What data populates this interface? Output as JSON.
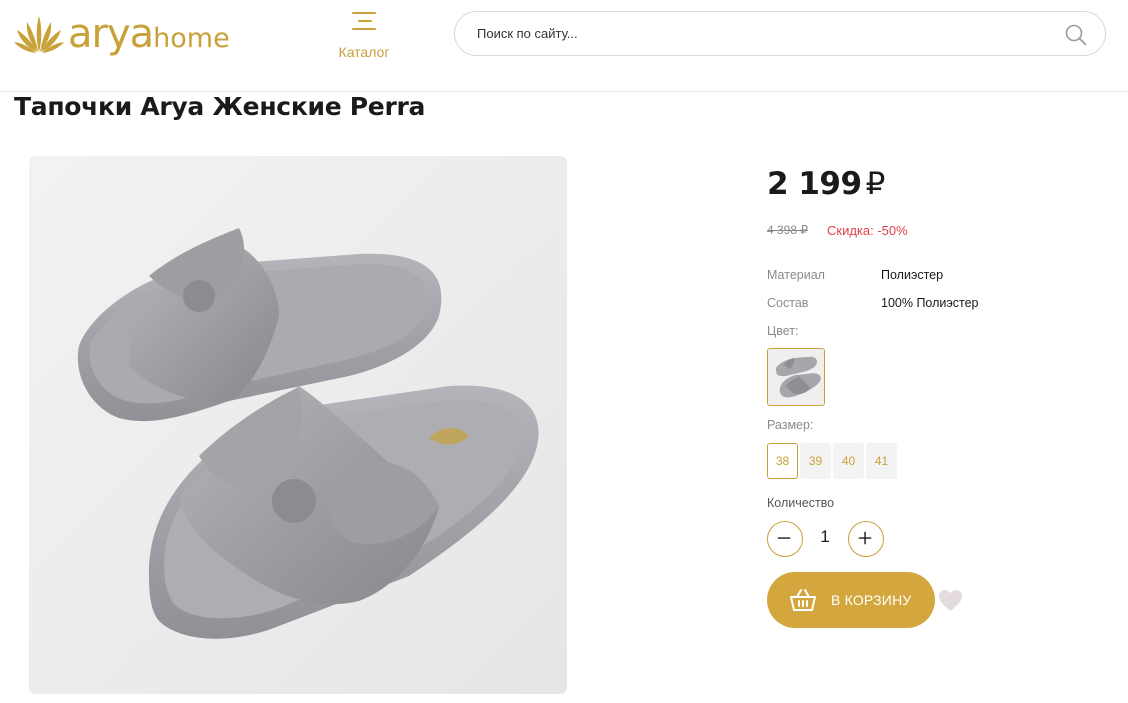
{
  "header": {
    "logo_alt": "aryahome",
    "logo_part1": "arya",
    "logo_part2": "home",
    "catalog_label": "Каталог",
    "search_placeholder": "Поиск по сайту..."
  },
  "product": {
    "title": "Тапочки Arya Женские Perra",
    "price": "2 199",
    "currency": "₽",
    "old_price": "4 398 ₽",
    "discount": "Скидка: -50%",
    "attributes": [
      {
        "key": "Материал",
        "value": "Полиэстер"
      },
      {
        "key": "Состав",
        "value": "100% Полиэстер"
      }
    ],
    "color_label": "Цвет:",
    "size_label": "Размер:",
    "sizes": [
      {
        "label": "38",
        "selected": true
      },
      {
        "label": "39",
        "selected": false
      },
      {
        "label": "40",
        "selected": false
      },
      {
        "label": "41",
        "selected": false
      }
    ],
    "quantity_label": "Количество",
    "quantity": "1",
    "cart_label": "В КОРЗИНУ"
  },
  "colors": {
    "accent": "#c9a13b",
    "button": "#d4a63e",
    "discount": "#e0424a",
    "muted": "#8a8a8a"
  },
  "icons": {
    "logo": "lotus-icon",
    "catalog": "menu-icon",
    "search": "search-icon",
    "cart": "basket-icon",
    "favorite": "heart-icon",
    "minus": "minus-icon",
    "plus": "plus-icon"
  }
}
